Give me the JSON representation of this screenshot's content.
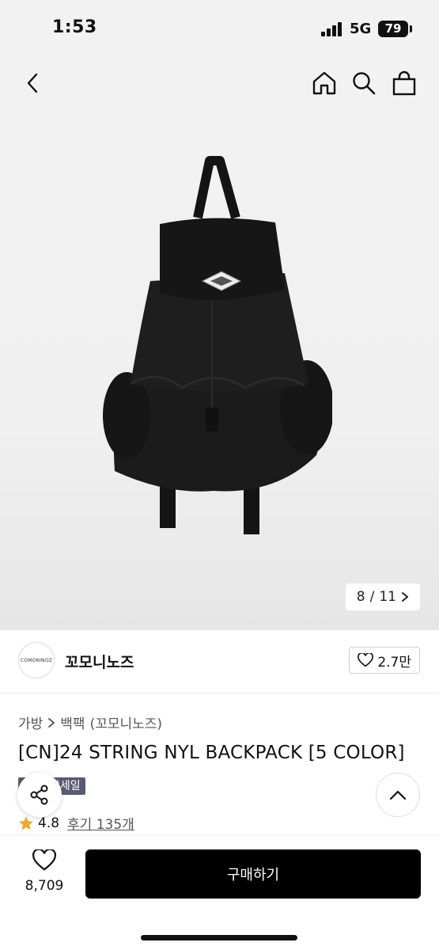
{
  "status": {
    "time": "1:53",
    "network": "5G",
    "battery": "79"
  },
  "nav": {
    "back_icon": "chevron-left-icon",
    "home_icon": "home-icon",
    "search_icon": "search-icon",
    "cart_icon": "shopping-bag-icon"
  },
  "gallery": {
    "current": "8",
    "separator": "/",
    "total": "11"
  },
  "brand": {
    "logo_text": "COMONINOZ",
    "name": "꼬모니노즈",
    "likes": "2.7만"
  },
  "breadcrumb": {
    "category": "가방",
    "subcategory": "백팩",
    "brand_paren": "(꼬모니노즈)"
  },
  "product": {
    "title": "[CN]24 STRING NYL BACKPACK [5 COLOR]",
    "badge": "시즌세일",
    "badge_visible": "상세일",
    "rating": "4.8",
    "reviews": "후기 135개"
  },
  "footer": {
    "wish_count": "8,709",
    "buy_label": "구매하기"
  },
  "colors": {
    "accent": "#000000",
    "badge": "#5a5a72",
    "star": "#f5a623"
  }
}
